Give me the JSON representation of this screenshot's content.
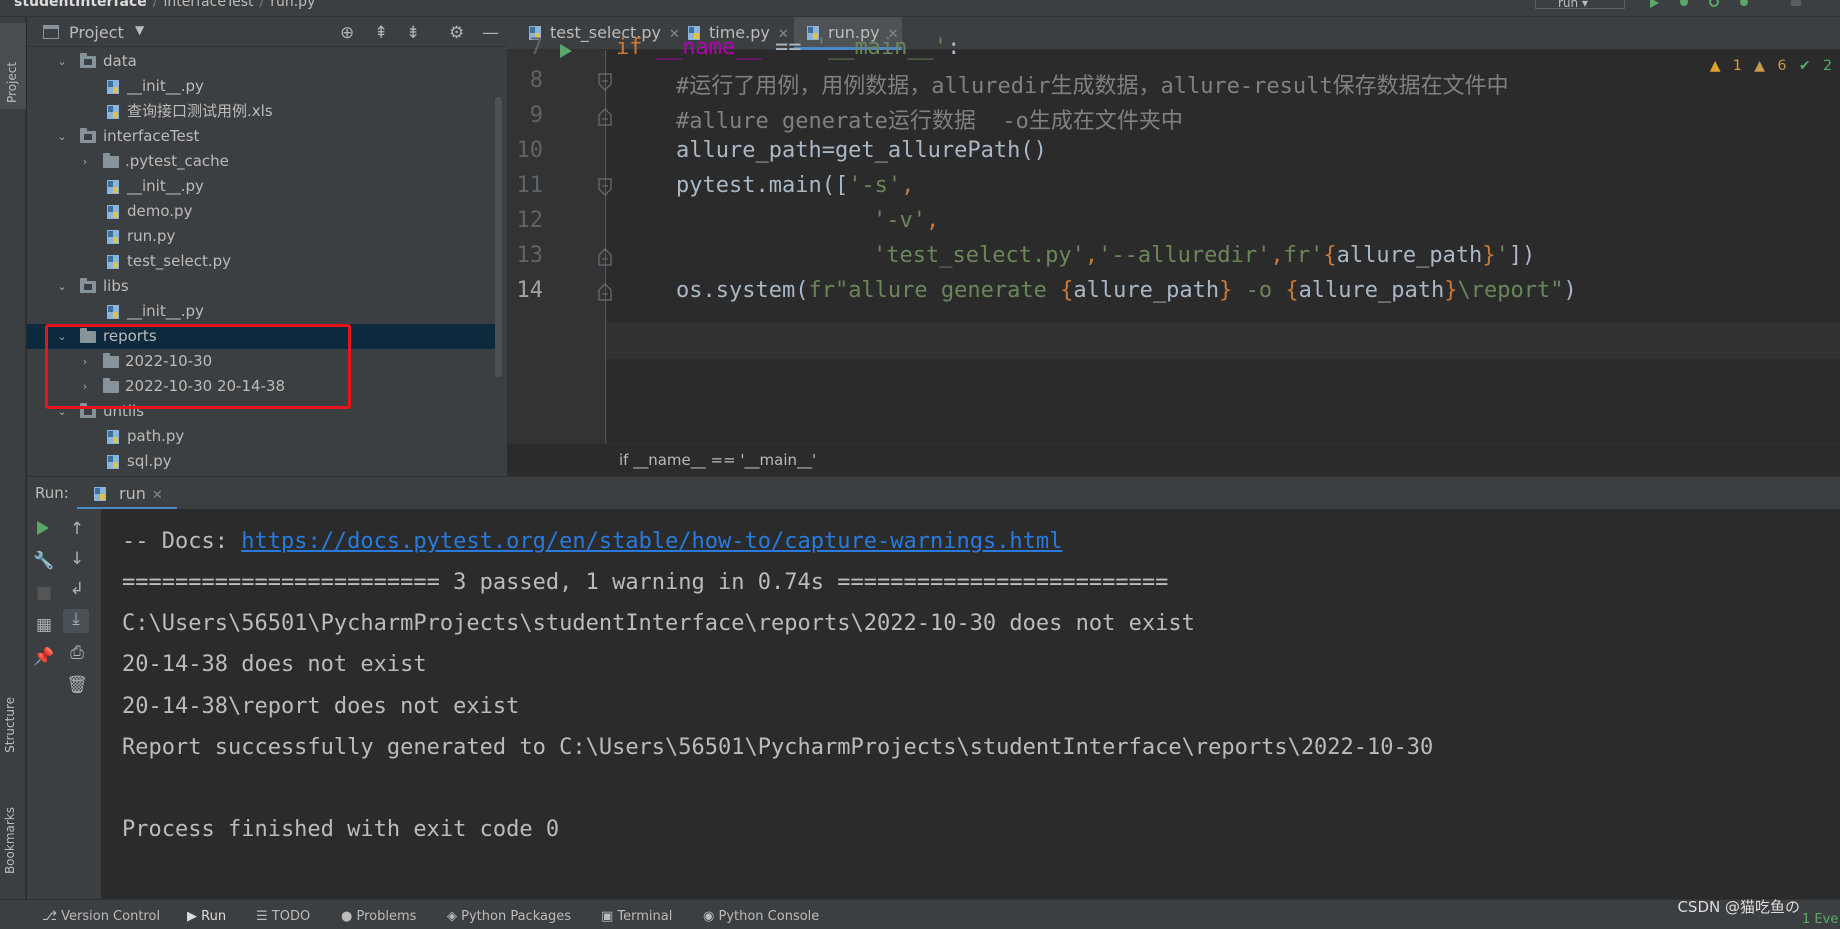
{
  "topbar": {
    "project_name": "studentInterface",
    "folder": "interfaceTest",
    "file": "run.py",
    "run_config": "run"
  },
  "left_stripe": {
    "project_tab": "Project",
    "structure_tab": "Structure",
    "bookmarks_tab": "Bookmarks"
  },
  "project_panel": {
    "title": "Project",
    "tree": [
      {
        "label": "data"
      },
      {
        "label": "__init__.py"
      },
      {
        "label": "查询接口测试用例.xls"
      },
      {
        "label": "interfaceTest"
      },
      {
        "label": ".pytest_cache"
      },
      {
        "label": "__init__.py"
      },
      {
        "label": "demo.py"
      },
      {
        "label": "run.py"
      },
      {
        "label": "test_select.py"
      },
      {
        "label": "libs"
      },
      {
        "label": "__init__.py"
      },
      {
        "label": "reports"
      },
      {
        "label": "2022-10-30"
      },
      {
        "label": "2022-10-30 20-14-38"
      },
      {
        "label": "untils"
      },
      {
        "label": "path.py"
      },
      {
        "label": "sql.py"
      }
    ]
  },
  "editor": {
    "tabs": [
      {
        "label": "test_select.py"
      },
      {
        "label": "time.py"
      },
      {
        "label": "run.py"
      }
    ],
    "indicators": {
      "warnings_a": "1",
      "warnings_b": "6",
      "ok": "2"
    },
    "lines": [
      {
        "num": "7"
      },
      {
        "num": "8",
        "text": "#运行了用例，用例数据，alluredir生成数据，allure-result保存数据在文件中"
      },
      {
        "num": "9",
        "text": "#allure generate运行数据  -o生成在文件夹中"
      },
      {
        "num": "10",
        "text": "allure_path=get_allurePath()"
      },
      {
        "num": "11",
        "a": "pytest.main([",
        "b": "'-s'",
        "c": ","
      },
      {
        "num": "12",
        "a": "'-v'",
        "b": ","
      },
      {
        "num": "13",
        "a": "'test_select.py'",
        "b": ",",
        "c": "'--alluredir'",
        "d": ",",
        "e": "fr'",
        "f": "{",
        "g": "allure_path",
        "h": "}",
        "i": "'",
        "j": "])"
      },
      {
        "num": "14",
        "a": "os.system(",
        "b": "fr\"allure generate ",
        "c": "{",
        "d": "allure_path",
        "e": "}",
        "f": " -o ",
        "g": "{",
        "h": "allure_path",
        "i": "}",
        "j": "\\report\"",
        "k": ")"
      }
    ],
    "line7": {
      "a": "if ",
      "b": "__name__",
      "c": " == ",
      "d": "'__main__'",
      "e": ":"
    },
    "breadcrumb": "if __name__ == '__main__'"
  },
  "run_panel": {
    "label": "Run:",
    "tab": "run",
    "console": {
      "docs_prefix": "-- Docs: ",
      "docs_link": "https://docs.pytest.org/en/stable/how-to/capture-warnings.html",
      "summary": "======================== 3 passed, 1 warning in 0.74s =========================",
      "line3": "C:\\Users\\56501\\PycharmProjects\\studentInterface\\reports\\2022-10-30 does not exist",
      "line4": "20-14-38 does not exist",
      "line5": "20-14-38\\report does not exist",
      "line6": "Report successfully generated to C:\\Users\\56501\\PycharmProjects\\studentInterface\\reports\\2022-10-30",
      "line7": "Process finished with exit code 0"
    }
  },
  "statusbar": {
    "items": [
      "Version Control",
      "Run",
      "TODO",
      "Problems",
      "Python Packages",
      "Terminal",
      "Python Console"
    ],
    "watermark": "CSDN @猫吃鱼の",
    "event_count": "1",
    "event_label": "Eve"
  },
  "colors": {
    "background": "#2b2b2b",
    "panel": "#3c3f41",
    "accent_tab": "#4a88c7",
    "highlight_box": "#e8141c",
    "link": "#287bde"
  }
}
